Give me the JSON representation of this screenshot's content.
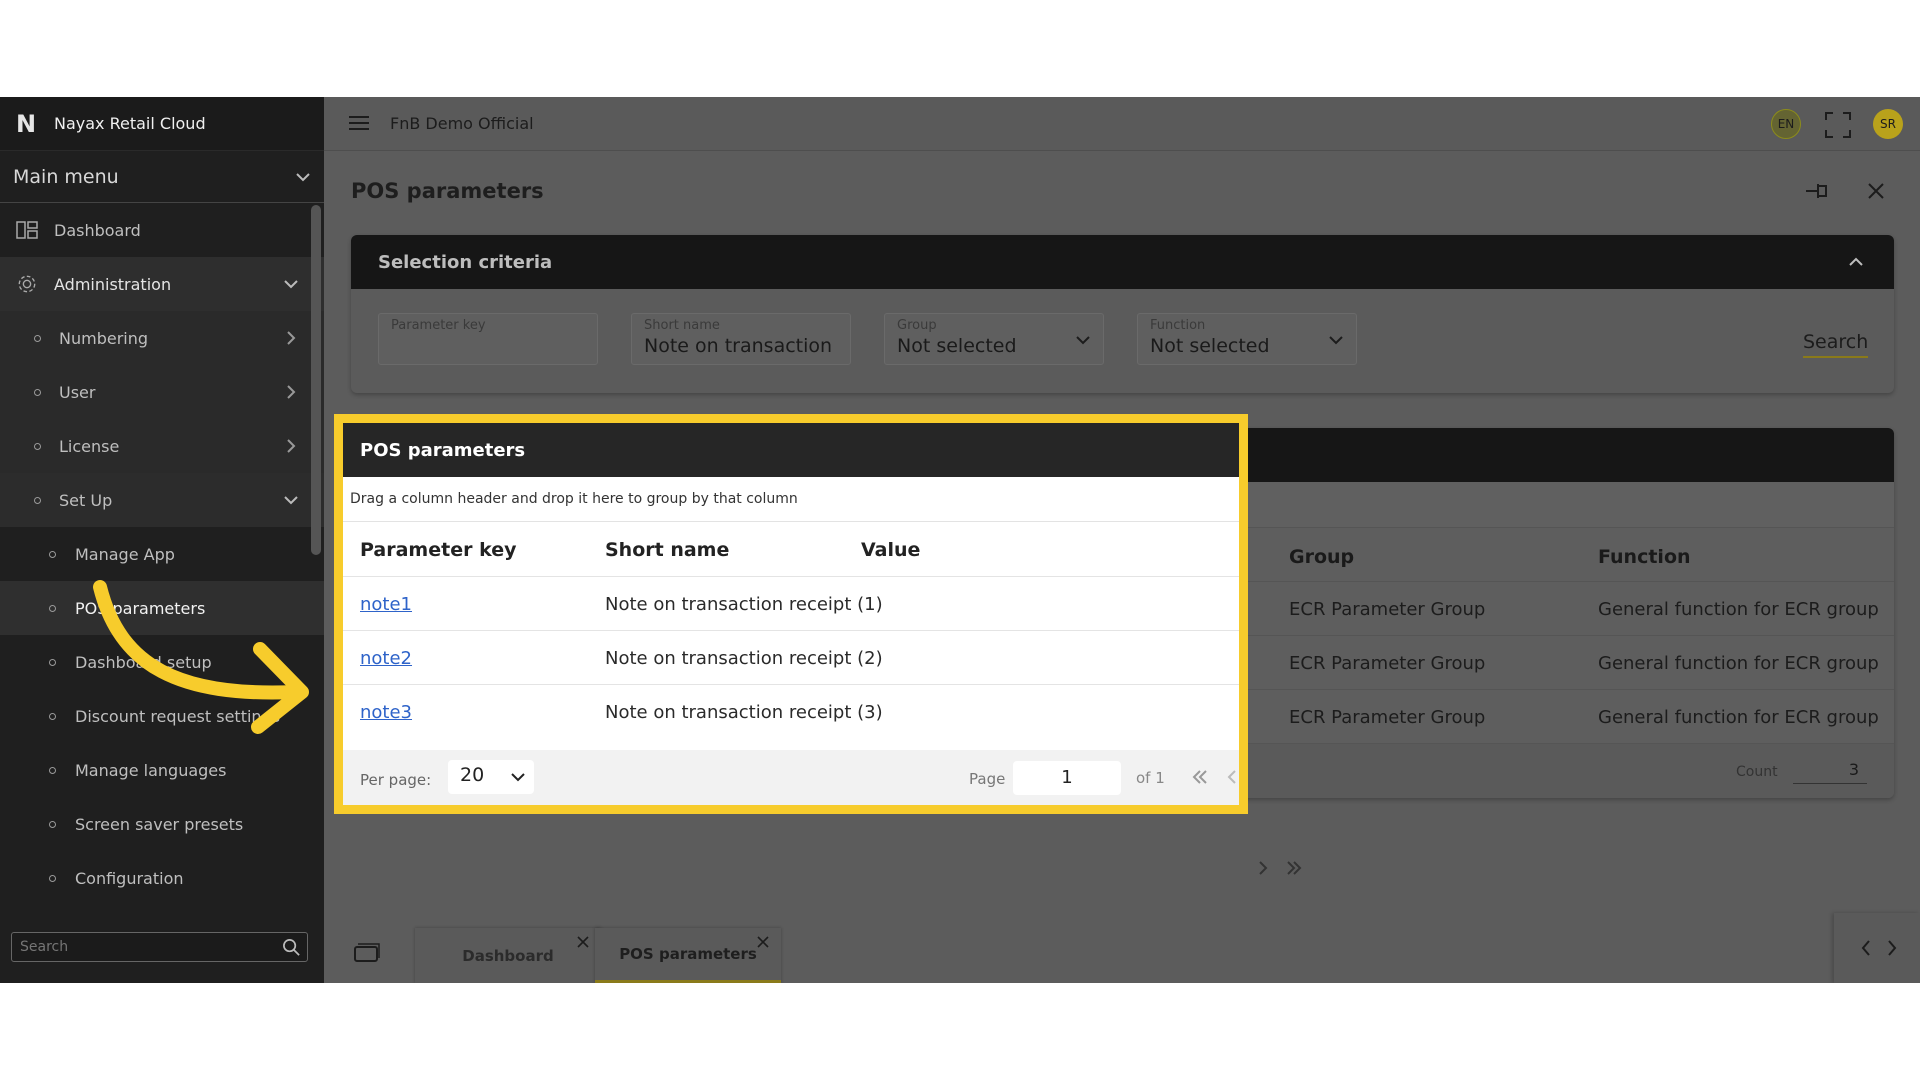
{
  "app": {
    "brand_logo": "N",
    "brand_name": "Nayax Retail Cloud",
    "company": "FnB Demo Official",
    "language": "EN",
    "user_initials": "SR"
  },
  "sidebar": {
    "main_menu": "Main menu",
    "items": [
      {
        "label": "Dashboard",
        "icon": "dashboard-icon"
      },
      {
        "label": "Administration",
        "icon": "gear-icon"
      },
      {
        "label": "Numbering"
      },
      {
        "label": "User"
      },
      {
        "label": "License"
      },
      {
        "label": "Set Up"
      },
      {
        "label": "Manage App"
      },
      {
        "label": "POS parameters"
      },
      {
        "label": "Dashboard setup"
      },
      {
        "label": "Discount request settings"
      },
      {
        "label": "Manage languages"
      },
      {
        "label": "Screen saver presets"
      },
      {
        "label": "Configuration"
      }
    ],
    "search_placeholder": "Search"
  },
  "page": {
    "title": "POS parameters"
  },
  "criteria": {
    "title": "Selection criteria",
    "fields": {
      "parameter_key": {
        "label": "Parameter key",
        "value": ""
      },
      "short_name": {
        "label": "Short name",
        "value": "Note on transaction"
      },
      "group": {
        "label": "Group",
        "value": "Not selected"
      },
      "function": {
        "label": "Function",
        "value": "Not selected"
      }
    },
    "search_label": "Search"
  },
  "grid": {
    "title": "POS parameters",
    "drag_hint": "Drag a column header and drop it here to group by that column",
    "columns": [
      "Parameter key",
      "Short name",
      "Value",
      "Group",
      "Function"
    ],
    "rows": [
      {
        "key": "note1",
        "short_name": "Note on transaction receipt (1)",
        "value": "",
        "group": "ECR Parameter Group",
        "function": "General function for ECR group"
      },
      {
        "key": "note2",
        "short_name": "Note on transaction receipt (2)",
        "value": "",
        "group": "ECR Parameter Group",
        "function": "General function for ECR group"
      },
      {
        "key": "note3",
        "short_name": "Note on transaction receipt (3)",
        "value": "",
        "group": "ECR Parameter Group",
        "function": "General function for ECR group"
      }
    ],
    "footer": {
      "per_page_label": "Per page:",
      "per_page": "20",
      "page_label": "Page",
      "page": "1",
      "of_label": "of 1",
      "count_label": "Count",
      "count": "3"
    }
  },
  "tabs": [
    {
      "label": "Dashboard"
    },
    {
      "label": "POS parameters",
      "active": true
    }
  ],
  "colors": {
    "highlight": "#f7cc2c",
    "link": "#2e63c9",
    "accent_underline": "#8a7a1a"
  }
}
